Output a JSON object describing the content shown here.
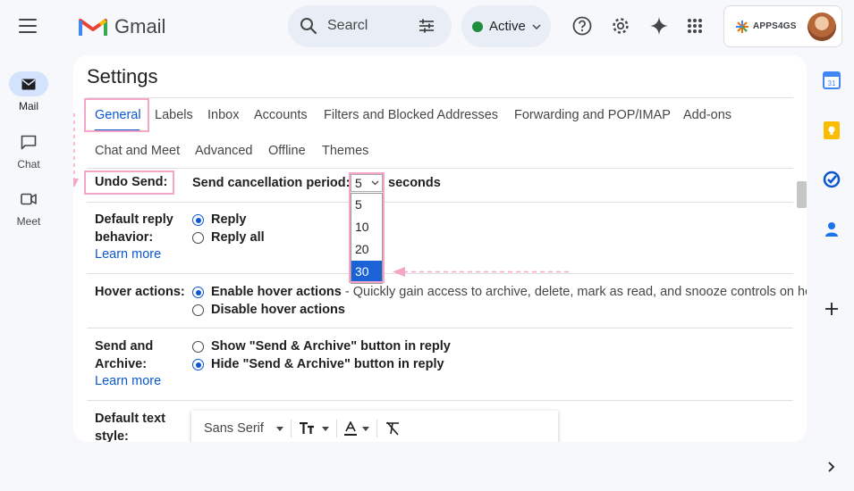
{
  "nav": {
    "items": [
      {
        "label": "Mail",
        "icon": "mail-icon"
      },
      {
        "label": "Chat",
        "icon": "chat-icon"
      },
      {
        "label": "Meet",
        "icon": "meet-icon"
      }
    ]
  },
  "header": {
    "app_name": "Gmail",
    "search_value": "Searcl",
    "status": "Active",
    "account_name": "APPS4GS"
  },
  "settings": {
    "title": "Settings",
    "tabs": [
      "General",
      "Labels",
      "Inbox",
      "Accounts",
      "Filters and Blocked Addresses",
      "Forwarding and POP/IMAP",
      "Add-ons",
      "Chat and Meet",
      "Advanced",
      "Offline",
      "Themes"
    ],
    "undo_send": {
      "label": "Undo Send:",
      "prefix": "Send cancellation period:",
      "selected": "5",
      "suffix": "seconds",
      "options": [
        "5",
        "10",
        "20",
        "30"
      ]
    },
    "reply": {
      "label": "Default reply behavior:",
      "options": [
        "Reply",
        "Reply all"
      ],
      "learn_more": "Learn more"
    },
    "hover": {
      "label": "Hover actions:",
      "enable": "Enable hover actions",
      "enable_desc": " - Quickly gain access to archive, delete, mark as read, and snooze controls on ho",
      "disable": "Disable hover actions"
    },
    "send_archive": {
      "label": "Send and Archive:",
      "show": "Show \"Send & Archive\" button in reply",
      "hide": "Hide \"Send & Archive\" button in reply",
      "learn_more": "Learn more"
    },
    "text_style": {
      "label": "Default text style:",
      "font": "Sans Serif"
    }
  },
  "colors": {
    "accent": "#0b57d0",
    "highlight": "#f4a5c8"
  }
}
